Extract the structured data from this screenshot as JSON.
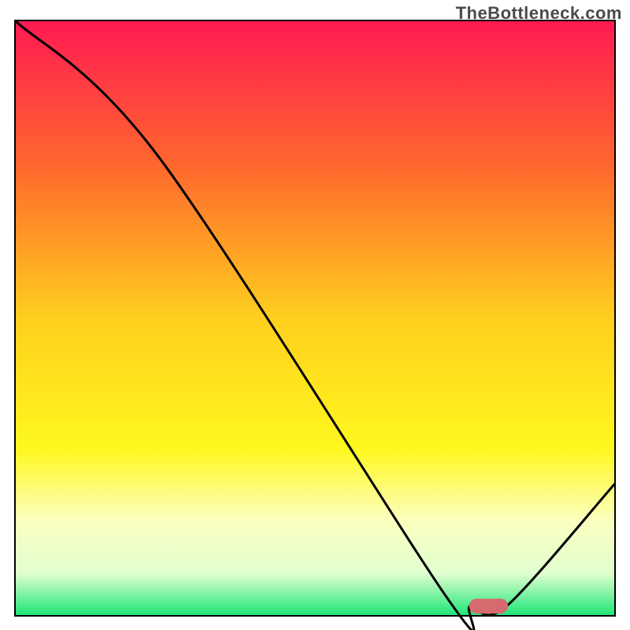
{
  "watermark": "TheBottleneck.com",
  "chart_data": {
    "type": "line",
    "title": "",
    "xlabel": "",
    "ylabel": "",
    "xlim": [
      0,
      100
    ],
    "ylim": [
      0,
      100
    ],
    "background_gradient": {
      "stops": [
        {
          "offset": 0,
          "color": "#ff1a52"
        },
        {
          "offset": 25,
          "color": "#ff6a2d"
        },
        {
          "offset": 50,
          "color": "#ffcf1e"
        },
        {
          "offset": 72,
          "color": "#fff81e"
        },
        {
          "offset": 84,
          "color": "#fcffbf"
        },
        {
          "offset": 93,
          "color": "#e0ffd0"
        },
        {
          "offset": 100,
          "color": "#1fe678"
        }
      ]
    },
    "series": [
      {
        "name": "bottleneck-curve",
        "color": "#000000",
        "x": [
          0,
          24,
          72,
          76,
          82,
          100
        ],
        "values": [
          100,
          77,
          3,
          1.5,
          1.5,
          22
        ]
      }
    ],
    "marker": {
      "name": "optimal-marker",
      "x_center": 79,
      "width": 6.5,
      "y": 1.5,
      "color": "#d66a6f",
      "thickness": 2.5
    }
  }
}
